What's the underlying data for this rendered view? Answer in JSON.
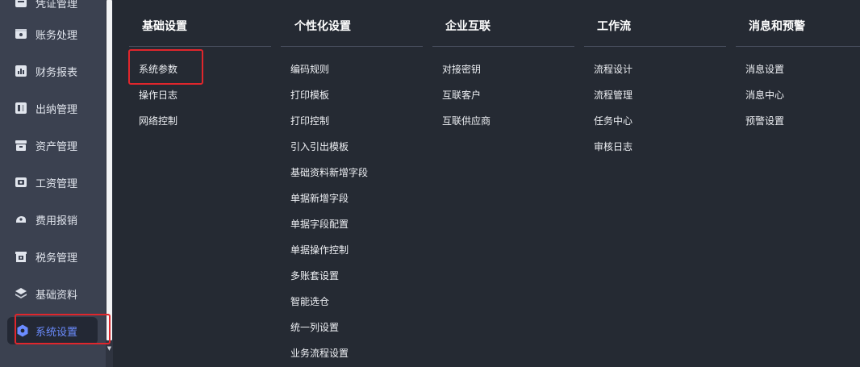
{
  "sidebar": {
    "top_partial_label": "凭证管理",
    "items": [
      {
        "label": "账务处理",
        "icon": "ledger-icon"
      },
      {
        "label": "财务报表",
        "icon": "report-icon"
      },
      {
        "label": "出纳管理",
        "icon": "cashier-icon"
      },
      {
        "label": "资产管理",
        "icon": "asset-box-icon"
      },
      {
        "label": "工资管理",
        "icon": "salary-icon"
      },
      {
        "label": "费用报销",
        "icon": "expense-icon"
      },
      {
        "label": "税务管理",
        "icon": "tax-icon"
      },
      {
        "label": "基础资料",
        "icon": "layers-icon"
      },
      {
        "label": "系统设置",
        "icon": "hexagon-gear-icon",
        "active": true
      }
    ]
  },
  "menu": {
    "columns": [
      {
        "title": "基础设置",
        "items": [
          "系统参数",
          "操作日志",
          "网络控制"
        ]
      },
      {
        "title": "个性化设置",
        "items": [
          "编码规则",
          "打印模板",
          "打印控制",
          "引入引出模板",
          "基础资料新增字段",
          "单据新增字段",
          "单据字段配置",
          "单据操作控制",
          "多账套设置",
          "智能选仓",
          "统一列设置",
          "业务流程设置"
        ]
      },
      {
        "title": "企业互联",
        "items": [
          "对接密钥",
          "互联客户",
          "互联供应商"
        ]
      },
      {
        "title": "工作流",
        "items": [
          "流程设计",
          "流程管理",
          "任务中心",
          "审核日志"
        ]
      },
      {
        "title": "消息和预警",
        "items": [
          "消息设置",
          "消息中心",
          "预警设置"
        ]
      }
    ]
  },
  "colors": {
    "sidebar_bg": "#3b4150",
    "panel_bg": "#252a33",
    "active_text": "#6b8cff",
    "highlight_border": "#e0262c"
  }
}
